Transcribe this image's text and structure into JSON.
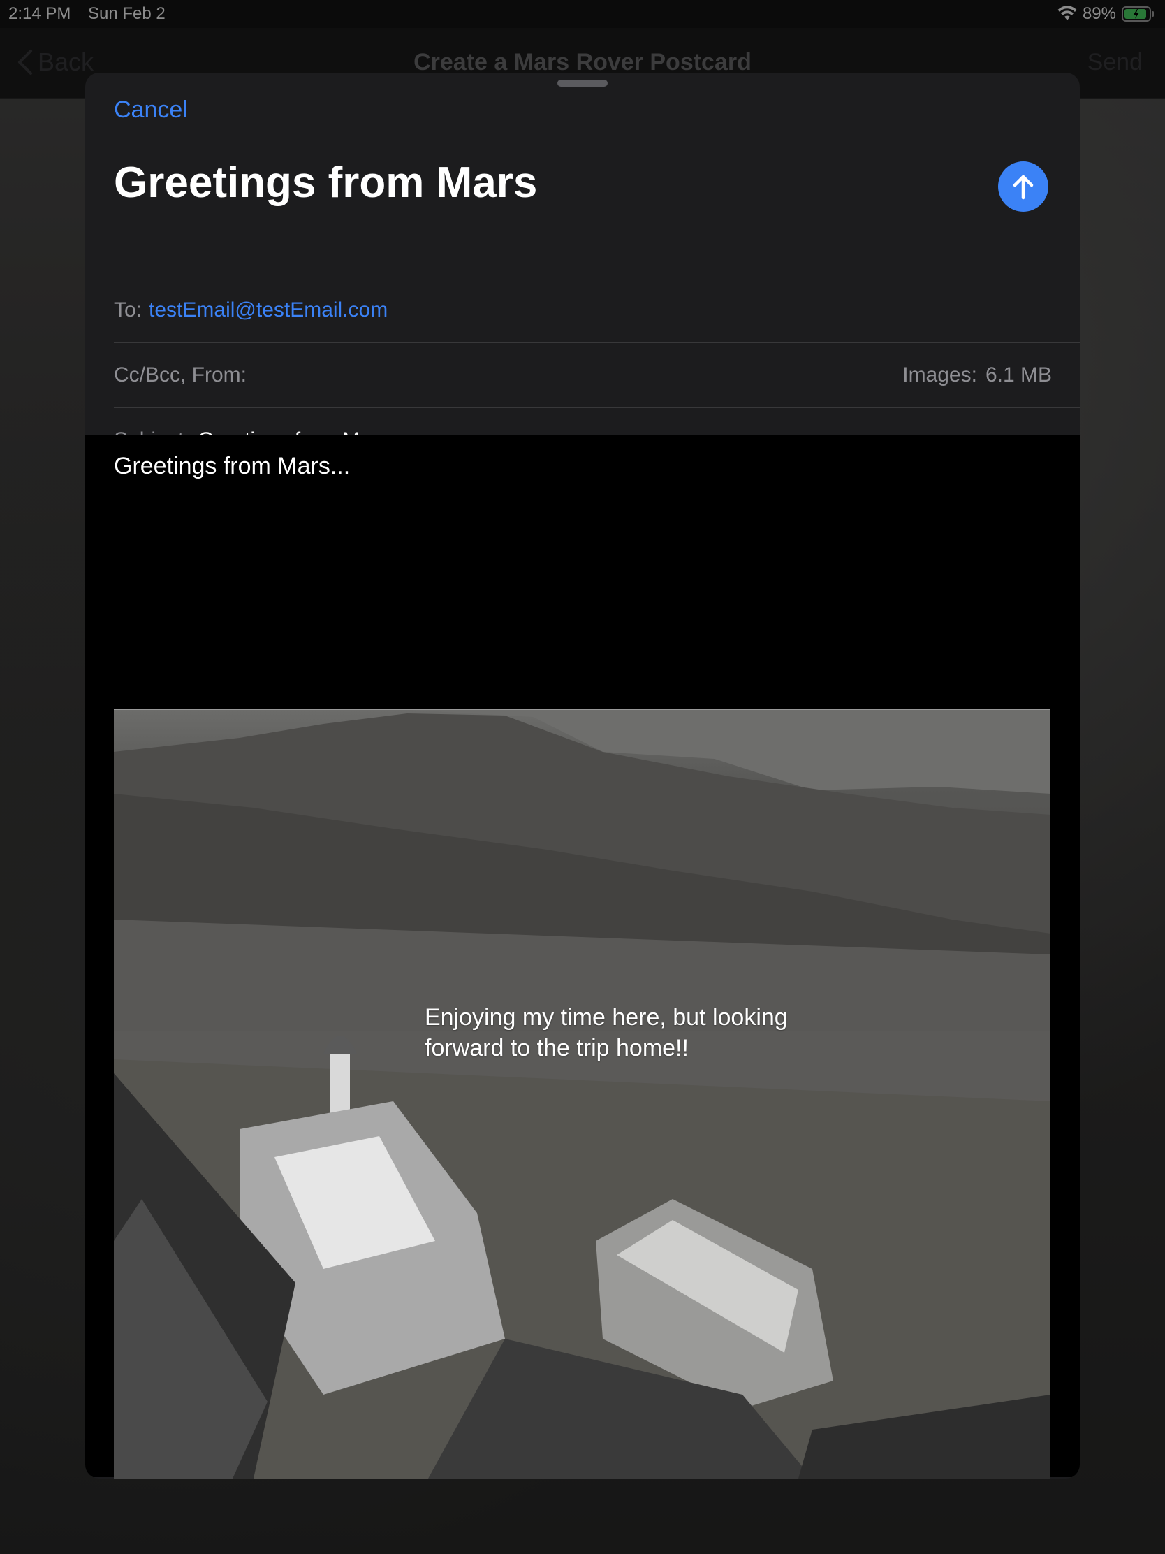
{
  "status_bar": {
    "time": "2:14 PM",
    "date": "Sun Feb 2",
    "battery": "89%"
  },
  "navbar": {
    "back_label": "Back",
    "title": "Create a Mars Rover Postcard",
    "send_label": "Send"
  },
  "compose": {
    "cancel_label": "Cancel",
    "subject_heading": "Greetings from Mars",
    "to_label": "To:",
    "to_value": "testEmail@testEmail.com",
    "ccbcc_label": "Cc/Bcc, From:",
    "images_label": "Images:",
    "images_size": "6.1 MB",
    "subject_label": "Subject:",
    "subject_value": "Greetings from Mars",
    "body_text": "Greetings from Mars...",
    "photo_caption_line1": "Enjoying my time here, but looking",
    "photo_caption_line2": "forward to the trip home!!"
  },
  "colors": {
    "accent": "#3b82f6",
    "sheet_bg": "#1c1c1e",
    "secondary_text": "#8e8e93"
  },
  "icons": [
    "wifi-icon",
    "battery-icon",
    "chevron-left-icon",
    "arrow-up-icon"
  ]
}
